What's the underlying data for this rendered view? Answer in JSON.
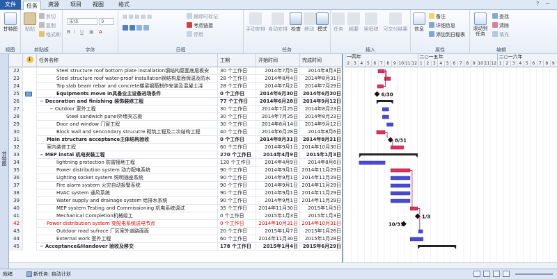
{
  "tabs": [
    {
      "label": "文件",
      "type": "file"
    },
    {
      "label": "任务",
      "type": "active"
    },
    {
      "label": "资源",
      "type": "normal"
    },
    {
      "label": "项目",
      "type": "normal"
    },
    {
      "label": "视图",
      "type": "normal"
    },
    {
      "label": "格式",
      "type": "context"
    }
  ],
  "ribbon": {
    "groups": {
      "view": "视图",
      "clipboard": "剪贴板",
      "font": "字体",
      "schedule": "日程",
      "tasks": "任务",
      "insert": "插入",
      "properties": "属性",
      "editing": "编辑"
    },
    "view": {
      "gantt": "甘特图"
    },
    "clipboard": {
      "paste": "粘贴",
      "cut": "剪切",
      "copy": "复制",
      "format_painter": "格式刷"
    },
    "font": {
      "family": "宋体",
      "size": "9"
    },
    "schedule": {
      "follow": "跟踪时标记",
      "respect_links": "考虑链接",
      "deactivate": "停用"
    },
    "tasks": {
      "manual": "手动安排",
      "auto": "自动安排",
      "inspect": "检查",
      "move": "移动",
      "mode": "模式"
    },
    "insert": {
      "task": "任务",
      "summary": "摘要",
      "milestone": "里程碑",
      "deliverable": "可交付结果"
    },
    "properties": {
      "info": "信息",
      "notes": "备注",
      "details": "详细信息",
      "add_timeline": "添加到日程表"
    },
    "editing": {
      "scroll": "滚动到任务",
      "find": "查找",
      "clear": "清除",
      "fill": "填充"
    }
  },
  "view_bar_label": "甘特图",
  "columns": {
    "name": "任务名称",
    "duration": "工期",
    "start": "开始时间",
    "finish": "完成时间"
  },
  "rows": [
    {
      "id": "22",
      "indent": 1,
      "name": "Steel structure roof bottom plate installation钢结构屋面底层板安",
      "duration": "30 个工作日",
      "start": "2014年7月5日",
      "finish": "2014年8月3日",
      "style": ""
    },
    {
      "id": "23",
      "indent": 1,
      "name": "Steel structure roof water-proof installation钢结构屋面保温及防水",
      "duration": "28 个工作日",
      "start": "2014年8月4日",
      "finish": "2014年8月31日",
      "style": ""
    },
    {
      "id": "24",
      "indent": 1,
      "name": "Top slab beam rebar and concrete楼梁钢筋制作安装及混凝土浇",
      "duration": "28 个工作日",
      "start": "2014年7月2日",
      "finish": "2014年7月29日",
      "style": ""
    },
    {
      "id": "25",
      "indent": 1,
      "name": "Equipments move in具备业主设备进场条件",
      "duration": "0 个工作日",
      "start": "2014年6月30日",
      "finish": "2014年6月30日",
      "style": "bold",
      "icon": true
    },
    {
      "id": "26",
      "indent": 0,
      "toggle": "−",
      "name": "Decoration and finishing 装饰装修工程",
      "duration": "77 个工作日",
      "start": "2014年6月28日",
      "finish": "2014年9月12日",
      "style": "bold"
    },
    {
      "id": "27",
      "indent": 1,
      "toggle": "−",
      "name": "Outdoor 室外工程",
      "duration": "30 个工作日",
      "start": "2014年7月25日",
      "finish": "2014年8月23日",
      "style": ""
    },
    {
      "id": "28",
      "indent": 2,
      "name": "Steel sandwich panel外墙夹芯板",
      "duration": "30 个工作日",
      "start": "2014年7月25日",
      "finish": "2014年8月23日",
      "style": ""
    },
    {
      "id": "29",
      "indent": 1,
      "name": "Door and window 门窗工程",
      "duration": "30 个工作日",
      "start": "2014年8月14日",
      "finish": "2014年9月12日",
      "style": ""
    },
    {
      "id": "30",
      "indent": 1,
      "name": "Block wall and sencondary strucutre  砌筑工程及二次结构工程",
      "duration": "40 个工作日",
      "start": "2014年6月28日",
      "finish": "2014年8月6日",
      "style": ""
    },
    {
      "id": "31",
      "indent": 0,
      "name": "Main structure acceptance主体结构验收",
      "duration": "0 个工作日",
      "start": "2014年8月31日",
      "finish": "2014年8月31日",
      "style": "bold"
    },
    {
      "id": "32",
      "indent": 0,
      "name": "室内装修工程",
      "duration": "60 个工作日",
      "start": "2014年9月1日",
      "finish": "2014年10月30日",
      "style": ""
    },
    {
      "id": "33",
      "indent": 0,
      "toggle": "−",
      "name": "MEP instal 机电安装工程",
      "duration": "270 个工作日",
      "start": "2014年4月9日",
      "finish": "2015年1月3日",
      "style": "bold"
    },
    {
      "id": "34",
      "indent": 1,
      "name": "lightning protection 防雷接地工程",
      "duration": "120 个工作日",
      "start": "2014年4月9日",
      "finish": "2014年8月6日",
      "style": ""
    },
    {
      "id": "35",
      "indent": 1,
      "name": "Power distribution system 动力配电系统",
      "duration": "90 个工作日",
      "start": "2014年9月1日",
      "finish": "2014年11月29日",
      "style": ""
    },
    {
      "id": "36",
      "indent": 1,
      "name": "Lighting socket system 照明插座系统",
      "duration": "90 个工作日",
      "start": "2014年9月1日",
      "finish": "2014年11月29日",
      "style": ""
    },
    {
      "id": "37",
      "indent": 1,
      "name": "Fire alarm system 火灾自动报警系统",
      "duration": "90 个工作日",
      "start": "2014年9月1日",
      "finish": "2014年11月29日",
      "style": ""
    },
    {
      "id": "38",
      "indent": 1,
      "name": "HVAC system 通风系统",
      "duration": "90 个工作日",
      "start": "2014年9月1日",
      "finish": "2014年11月29日",
      "style": ""
    },
    {
      "id": "39",
      "indent": 1,
      "name": "Water supply and drainage system 给排水系统",
      "duration": "90 个工作日",
      "start": "2014年9月1日",
      "finish": "2014年11月29日",
      "style": ""
    },
    {
      "id": "40",
      "indent": 1,
      "name": "MEP system Testing and Commissioning 机电系统调试",
      "duration": "35 个工作日",
      "start": "2014年11月30日",
      "finish": "2015年1月3日",
      "style": ""
    },
    {
      "id": "41",
      "indent": 1,
      "name": "Mechanical Completion机械竣工",
      "duration": "0 个工作日",
      "start": "2015年1月3日",
      "finish": "2015年1月3日",
      "style": ""
    },
    {
      "id": "42",
      "indent": 0,
      "name": "Power distribution system 变配电系统送电节点",
      "duration": "0 个工作日",
      "start": "2014年10月31日",
      "finish": "2014年10月31日",
      "style": "red"
    },
    {
      "id": "43",
      "indent": 1,
      "name": "Outdoor road sufrace 厂区室外道路面面",
      "duration": "20 个工作日",
      "start": "2015年1月7日",
      "finish": "2015年1月26日",
      "style": ""
    },
    {
      "id": "44",
      "indent": 1,
      "name": "External work 室外工程",
      "duration": "60 个工作日",
      "start": "2014年11月30日",
      "finish": "2015年1月28日",
      "style": ""
    },
    {
      "id": "45",
      "indent": 0,
      "toggle": "−",
      "name": "Acceptance&Handover 验收及移交",
      "duration": "178 个工作日",
      "start": "2015年1月4日",
      "finish": "2015年6月29日",
      "style": "bold"
    }
  ],
  "timescale": {
    "years": [
      "一四年",
      "二○一五年",
      "二○一六年"
    ],
    "months": [
      "2",
      "3",
      "4",
      "5",
      "6",
      "7",
      "8",
      "9",
      "10",
      "11",
      "12",
      "1",
      "2",
      "3",
      "4",
      "5",
      "6",
      "7",
      "8",
      "9",
      "10",
      "11",
      "12",
      "1",
      "2",
      "3",
      "4",
      "5",
      "6",
      "7",
      "8",
      "9"
    ]
  },
  "milestone_labels": {
    "m25": "6/30",
    "m31": "8/31",
    "m41": "1/3",
    "m42": "10/31"
  },
  "status": {
    "ready": "就绪",
    "new_tasks": "新任务: 自动计划"
  },
  "colors": {
    "task_bar": "#4a4ad6",
    "critical_bar": "#e03060",
    "summary_bar": "#222222",
    "link": "#b00030",
    "milestone": "#111111"
  }
}
